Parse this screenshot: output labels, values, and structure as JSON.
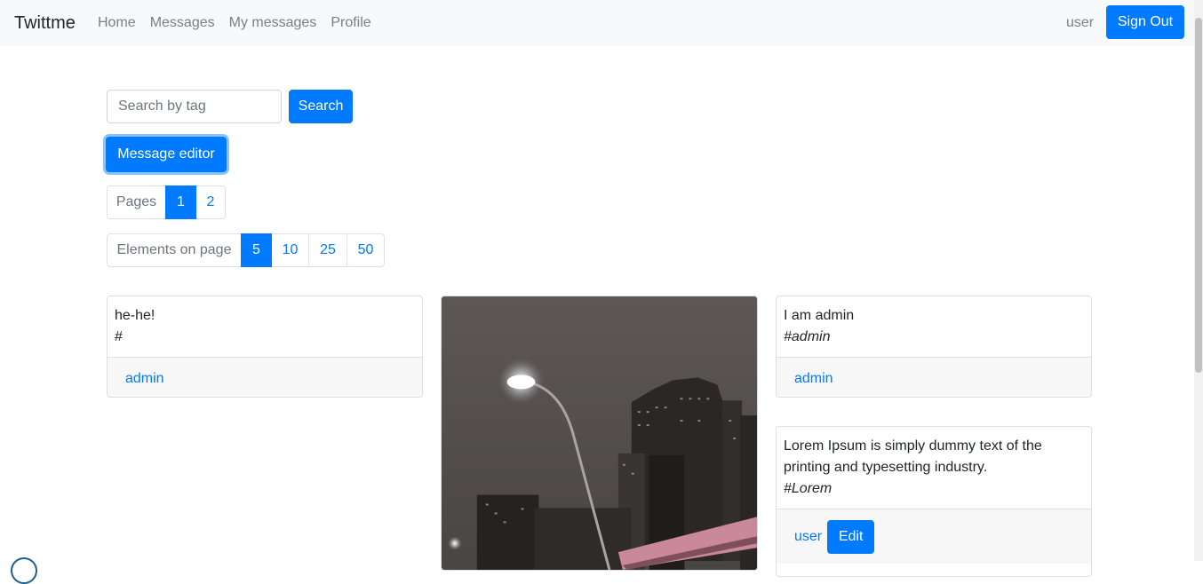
{
  "navbar": {
    "brand": "Twittme",
    "links": [
      "Home",
      "Messages",
      "My messages",
      "Profile"
    ],
    "username": "user",
    "signout_label": "Sign Out"
  },
  "search": {
    "placeholder": "Search by tag",
    "value": "",
    "button_label": "Search"
  },
  "editor_button_label": "Message editor",
  "pages": {
    "label": "Pages",
    "items": [
      "1",
      "2"
    ],
    "active": "1"
  },
  "elements_on_page": {
    "label": "Elements on page",
    "items": [
      "5",
      "10",
      "25",
      "50"
    ],
    "active": "5"
  },
  "messages": [
    {
      "text": "he-he!",
      "tag": "#",
      "author": "admin"
    },
    {
      "image": "night-city-photo"
    },
    {
      "text": "I am admin",
      "tag": "#admin",
      "author": "admin"
    },
    {
      "text": "Lorem Ipsum is simply dummy text of the printing and typesetting industry.",
      "tag": "#Lorem",
      "author": "user",
      "edit_label": "Edit"
    }
  ],
  "colors": {
    "primary": "#007bff",
    "navbar_bg": "#f8f9fa",
    "footer_bg": "#f7f7f7"
  }
}
